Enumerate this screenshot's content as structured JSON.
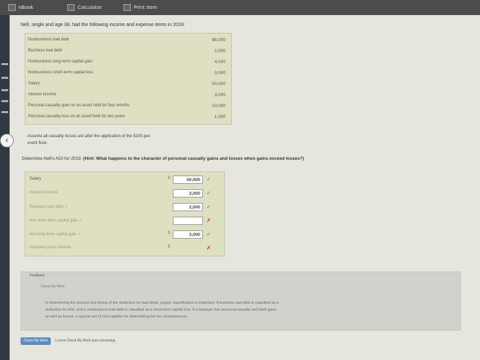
{
  "tabs": [
    {
      "label": "eBook"
    },
    {
      "label": "Calculator"
    },
    {
      "label": "Print Item"
    }
  ],
  "problem": {
    "intro": "Nell, single and age 38, had the following income and expense items in 2019:",
    "items": [
      {
        "label": "Nonbusiness bad debt",
        "amount": "$6,000"
      },
      {
        "label": "Business bad debt",
        "amount": "2,000"
      },
      {
        "label": "Nonbusiness long-term capital gain",
        "amount": "4,000"
      },
      {
        "label": "Nonbusiness short-term capital loss",
        "amount": "3,000"
      },
      {
        "label": "Salary",
        "amount": "50,000"
      },
      {
        "label": "Interest income",
        "amount": "3,000"
      },
      {
        "label": "Personal casualty gain on an asset held for four months",
        "amount": "10,000"
      },
      {
        "label": "Personal casualty loss on an asset held for two years",
        "amount": "1,000"
      }
    ],
    "assume_line1": "Assume all casualty losses are after the application of the $100-per-",
    "assume_line2": "event floor.",
    "determine_plain": "Determine Nell's AGI for 2019.",
    "determine_hint": "(Hint: What happens to the character of personal casualty gains and losses when gains exceed losses?)"
  },
  "answer_rows": [
    {
      "label": "Salary",
      "dollar": "$",
      "value": "50,000",
      "mark": "✓",
      "status": "correct"
    },
    {
      "label": "Interest income",
      "dollar": "",
      "value": "3,000",
      "mark": "✓",
      "status": "correct"
    },
    {
      "label": "Business bad debt ✓",
      "dollar": "",
      "value": "2,000",
      "mark": "✓",
      "status": "correct"
    },
    {
      "label": "Net short-term capital gain ✓",
      "dollar": "",
      "value": "",
      "mark": "✗",
      "status": "incorrect"
    },
    {
      "label": "Net long-term capital gain ✓",
      "dollar": "$",
      "value": "3,000",
      "mark": "✓",
      "status": "correct"
    },
    {
      "label": "Adjusted gross income",
      "dollar": "$",
      "value": "",
      "mark": "✗",
      "status": "incorrect"
    }
  ],
  "feedback": {
    "title": "Feedback",
    "subtitle": "Check My Work",
    "lines": [
      "In determining the amount and timing of the deduction for bad debts, proper classification is important. A business bad debt is classified as a",
      "deduction for AGI, and a nonbusiness bad debt is classified as a short-term capital loss. If a taxpayer has personal casualty and theft gains",
      "as well as losses, a special set of rules applies for determining the tax consequences."
    ]
  },
  "footer": {
    "check_label": "Check My Work",
    "note": "1 more Check My Work uses remaining."
  },
  "colors": {
    "correct": "#3a9a3a",
    "incorrect": "#d23a2a"
  }
}
